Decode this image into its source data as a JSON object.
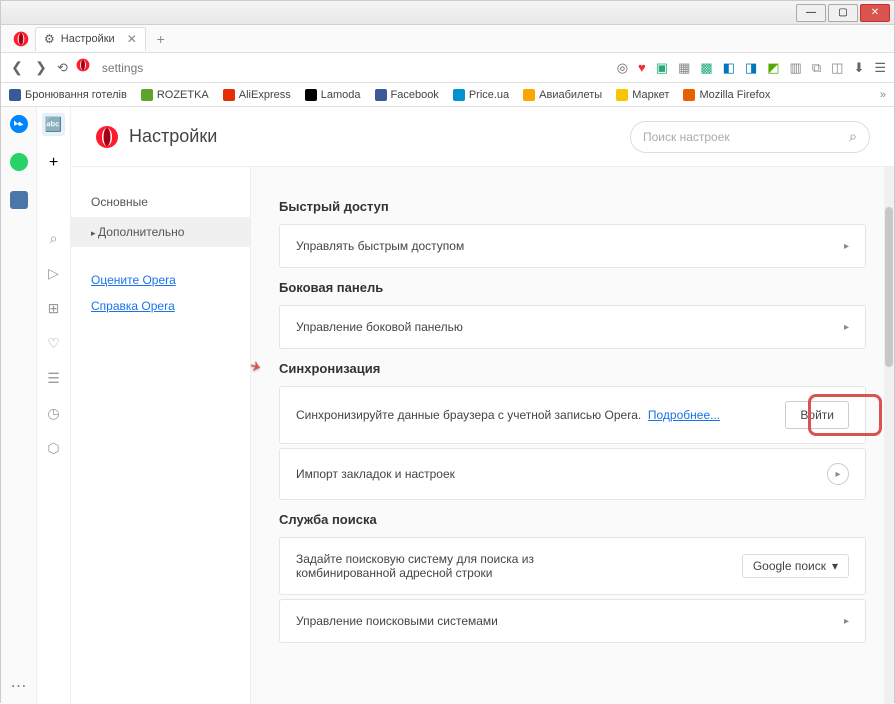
{
  "window": {
    "tab_title": "Настройки"
  },
  "toolbar": {
    "address": "settings"
  },
  "bookmarks": [
    {
      "label": "Бронювання готелів",
      "color": "#3b5998"
    },
    {
      "label": "ROZETKA",
      "color": "#5ba52a"
    },
    {
      "label": "AliExpress",
      "color": "#e62e04"
    },
    {
      "label": "Lamoda",
      "color": "#000"
    },
    {
      "label": "Facebook",
      "color": "#3b5998"
    },
    {
      "label": "Price.ua",
      "color": "#0093d0"
    },
    {
      "label": "Авиабилеты",
      "color": "#ffa500"
    },
    {
      "label": "Маркет",
      "color": "#f7c600"
    },
    {
      "label": "Mozilla Firefox",
      "color": "#e66000"
    }
  ],
  "settings": {
    "title": "Настройки",
    "search_placeholder": "Поиск настроек",
    "nav": {
      "basic": "Основные",
      "advanced": "Дополнительно",
      "rate": "Оцените Opera",
      "help": "Справка Opera"
    },
    "sections": {
      "quick_access": {
        "title": "Быстрый доступ",
        "manage": "Управлять быстрым доступом"
      },
      "sidebar": {
        "title": "Боковая панель",
        "manage": "Управление боковой панелью"
      },
      "sync": {
        "title": "Синхронизация",
        "desc": "Синхронизируйте данные браузера с учетной записью Opera.",
        "more": "Подробнее...",
        "login": "Войти",
        "import": "Импорт закладок и настроек"
      },
      "search": {
        "title": "Служба поиска",
        "desc": "Задайте поисковую систему для поиска из комбинированной адресной строки",
        "engine": "Google поиск",
        "manage": "Управление поисковыми системами"
      }
    }
  }
}
